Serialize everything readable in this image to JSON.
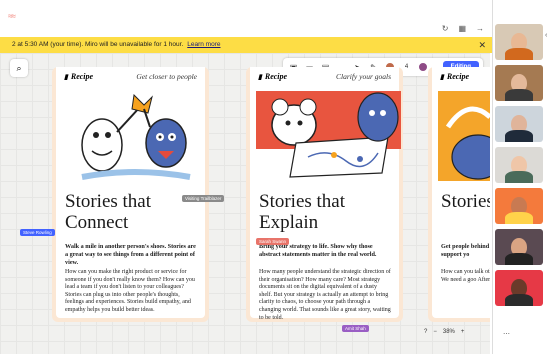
{
  "banner": {
    "text": "2 at 5:30 AM (your time). Miro will be unavailable for 1 hour.",
    "link": "Learn more"
  },
  "toolbar": {
    "editing_label": "Editing",
    "participant_count": "4"
  },
  "cards": [
    {
      "label": "Recipe",
      "tag": "Get closer to people",
      "title": "Stories that Connect",
      "lead": "Walk a mile in another person's shoes. Stories are a great way to see things from a different point of view.",
      "body": "How can you make the right product or service for someone if you don't really know them? How can you lead a team if you don't listen to your colleagues? Stories can plug us into other people's thoughts, feelings and experiences. Stories build empathy, and empathy helps you build better ideas."
    },
    {
      "label": "Recipe",
      "tag": "Clarify your goals",
      "title": "Stories that Explain",
      "lead": "Bring your strategy to life. Show why those abstract statements matter in the real world.",
      "body": "How many people understand the strategic direction of their organisation? How many care? Most strategy documents sit on the digital equivalent of a dusty shelf. But your strategy is actually an attempt to bring clarity to chaos, to choose your path through a changing world. That sounds like a great story, waiting to be told."
    },
    {
      "label": "Recipe",
      "tag": "",
      "title": "Stories that Motiv",
      "lead": "Get people behind your ideas with faith and support yo",
      "body": "How can you talk other show us a plan; the c world. We need a goo After all, you're askin possible."
    }
  ],
  "cursors": {
    "a": "Steve Rowling",
    "b": "Visiting Trailblazer",
    "c": "Sarah Swann",
    "d": "Amit Shah"
  },
  "zoom": "38%",
  "colors": {
    "banner": "#fddd45",
    "accent": "#4262ff",
    "card_frame": "#fbe7d4"
  }
}
